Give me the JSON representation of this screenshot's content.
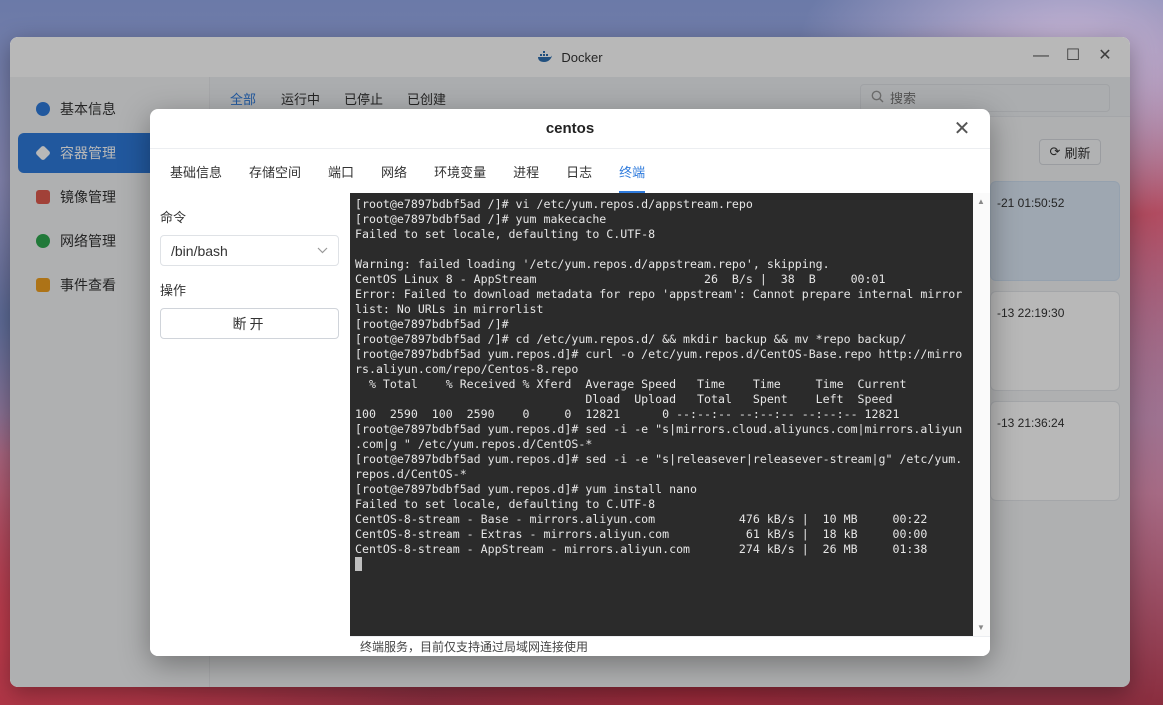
{
  "window": {
    "title": "Docker",
    "controls": {
      "minimize": "—",
      "maximize": "☐",
      "close": "✕"
    }
  },
  "sidebar": {
    "items": [
      {
        "label": "基本信息",
        "icon": "docker-icon",
        "color": "#2f7bdc"
      },
      {
        "label": "容器管理",
        "icon": "container-icon",
        "color": "#ffffff",
        "active": true
      },
      {
        "label": "镜像管理",
        "icon": "image-icon",
        "color": "#e05a4e"
      },
      {
        "label": "网络管理",
        "icon": "globe-icon",
        "color": "#2fa84f"
      },
      {
        "label": "事件查看",
        "icon": "calendar-icon",
        "color": "#f0a020"
      }
    ]
  },
  "topbar": {
    "tabs": [
      "全部",
      "运行中",
      "已停止",
      "已创建"
    ],
    "active_tab": "全部",
    "search_placeholder": "搜索"
  },
  "refresh_label": "刷新",
  "cards": [
    {
      "timestamp": "-21 01:50:52"
    },
    {
      "timestamp": "-13 22:19:30"
    },
    {
      "timestamp": "-13 21:36:24"
    }
  ],
  "modal": {
    "title": "centos",
    "close": "✕",
    "tabs": [
      "基础信息",
      "存储空间",
      "端口",
      "网络",
      "环境变量",
      "进程",
      "日志",
      "终端"
    ],
    "active_tab": "终端",
    "command_label": "命令",
    "command_value": "/bin/bash",
    "action_label": "操作",
    "disconnect_label": "断开",
    "footer_note": "终端服务，目前仅支持通过局域网连接使用"
  },
  "terminal": {
    "lines": [
      "[root@e7897bdbf5ad /]# vi /etc/yum.repos.d/appstream.repo",
      "[root@e7897bdbf5ad /]# yum makecache",
      "Failed to set locale, defaulting to C.UTF-8",
      "",
      "Warning: failed loading '/etc/yum.repos.d/appstream.repo', skipping.",
      "CentOS Linux 8 - AppStream                        26  B/s |  38  B     00:01",
      "Error: Failed to download metadata for repo 'appstream': Cannot prepare internal mirror",
      "list: No URLs in mirrorlist",
      "[root@e7897bdbf5ad /]#",
      "[root@e7897bdbf5ad /]# cd /etc/yum.repos.d/ && mkdir backup && mv *repo backup/",
      "[root@e7897bdbf5ad yum.repos.d]# curl -o /etc/yum.repos.d/CentOS-Base.repo http://mirro",
      "rs.aliyun.com/repo/Centos-8.repo",
      "  % Total    % Received % Xferd  Average Speed   Time    Time     Time  Current",
      "                                 Dload  Upload   Total   Spent    Left  Speed",
      "100  2590  100  2590    0     0  12821      0 --:--:-- --:--:-- --:--:-- 12821",
      "[root@e7897bdbf5ad yum.repos.d]# sed -i -e \"s|mirrors.cloud.aliyuncs.com|mirrors.aliyun",
      ".com|g \" /etc/yum.repos.d/CentOS-*",
      "[root@e7897bdbf5ad yum.repos.d]# sed -i -e \"s|releasever|releasever-stream|g\" /etc/yum.",
      "repos.d/CentOS-*",
      "[root@e7897bdbf5ad yum.repos.d]# yum install nano",
      "Failed to set locale, defaulting to C.UTF-8",
      "CentOS-8-stream - Base - mirrors.aliyun.com            476 kB/s |  10 MB     00:22",
      "CentOS-8-stream - Extras - mirrors.aliyun.com           61 kB/s |  18 kB     00:00",
      "CentOS-8-stream - AppStream - mirrors.aliyun.com       274 kB/s |  26 MB     01:38"
    ]
  }
}
